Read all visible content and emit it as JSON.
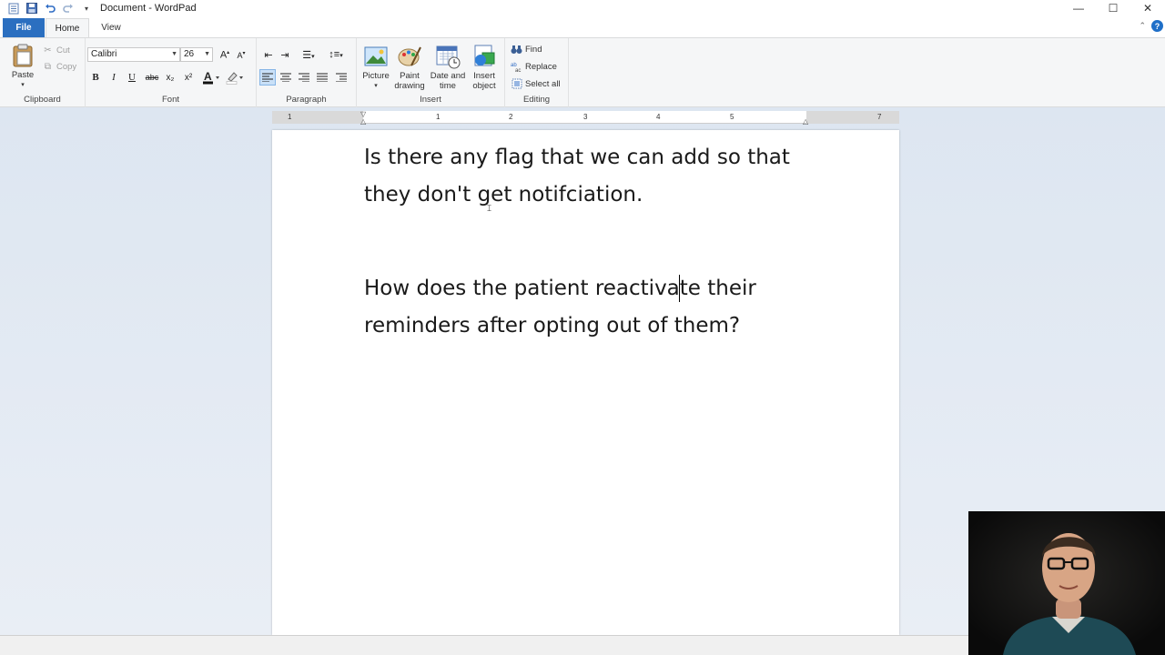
{
  "window": {
    "title": "Document - WordPad",
    "controls": {
      "minimize": "—",
      "maximize": "☐",
      "close": "✕"
    }
  },
  "quick_access": {
    "icons": [
      "wordpad-app-icon",
      "save-icon",
      "undo-icon",
      "redo-icon",
      "customize-qat-icon"
    ]
  },
  "tabs": [
    {
      "label": "File"
    },
    {
      "label": "Home"
    },
    {
      "label": "View"
    }
  ],
  "ribbon": {
    "clipboard": {
      "label": "Clipboard",
      "paste": "Paste",
      "cut": "Cut",
      "copy": "Copy"
    },
    "font": {
      "label": "Font",
      "family": "Calibri",
      "size": "26",
      "bold": "B",
      "italic": "I",
      "underline": "U",
      "strikethrough": "abc",
      "subscript": "x₂",
      "superscript": "x²"
    },
    "paragraph": {
      "label": "Paragraph"
    },
    "insert": {
      "label": "Insert",
      "picture": "Picture",
      "paint_drawing_1": "Paint",
      "paint_drawing_2": "drawing",
      "date_time_1": "Date and",
      "date_time_2": "time",
      "insert_object_1": "Insert",
      "insert_object_2": "object"
    },
    "editing": {
      "label": "Editing",
      "find": "Find",
      "replace": "Replace",
      "select_all": "Select all"
    }
  },
  "ruler": {
    "numbers": [
      "1",
      "1",
      "2",
      "3",
      "4",
      "5",
      "7"
    ]
  },
  "document": {
    "paragraphs": [
      {
        "line1": "Is there any flag that we can add so that",
        "line2": "they don't get notifciation."
      },
      {
        "line1": "How does the patient reactivate their",
        "line2": "reminders after opting out of them?"
      }
    ]
  },
  "colors": {
    "file_tab": "#2b6fc0",
    "ribbon_bg": "#f5f6f7",
    "workspace_bg": "#dde6f1"
  }
}
